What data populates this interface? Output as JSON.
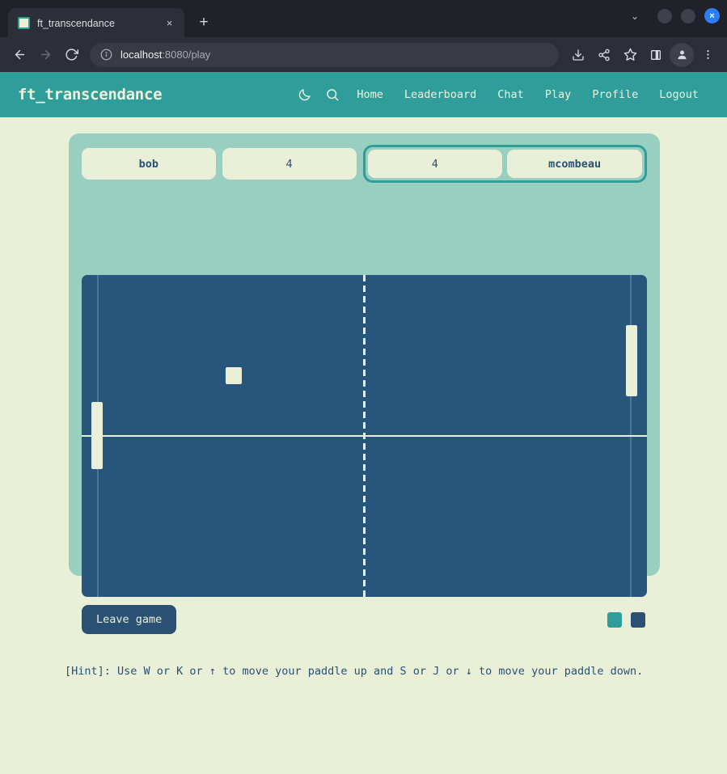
{
  "browser": {
    "tab": {
      "title": "ft_transcendance",
      "favicon": "app-favicon",
      "close_label": "×"
    },
    "new_tab_label": "+",
    "tab_list_chevron": "⌄",
    "window": {
      "minimize": "",
      "maximize": "",
      "close_label": "×"
    },
    "url": {
      "prefix": "localhost",
      "suffix": ":8080/play",
      "full": "localhost:8080/play"
    },
    "nav": {
      "back": "←",
      "forward": "→",
      "reload": "↻"
    }
  },
  "navbar": {
    "brand": "ft_transcendance",
    "icons": [
      {
        "name": "moon-icon",
        "label": "Toggle dark mode"
      },
      {
        "name": "search-icon",
        "label": "Search"
      }
    ],
    "links": [
      {
        "label": "Home"
      },
      {
        "label": "Leaderboard"
      },
      {
        "label": "Chat"
      },
      {
        "label": "Play"
      },
      {
        "label": "Profile"
      },
      {
        "label": "Logout"
      }
    ]
  },
  "game": {
    "players": {
      "left": {
        "name": "bob",
        "score": "4",
        "highlighted": false
      },
      "right": {
        "name": "mcombeau",
        "score": "4",
        "highlighted": true
      }
    },
    "leave_button": "Leave game",
    "swatches": [
      {
        "name": "swatch-cream",
        "color": "#eaf0d8"
      },
      {
        "name": "swatch-teal",
        "color": "#2f9e9a"
      },
      {
        "name": "swatch-navy",
        "color": "#2a5074"
      }
    ],
    "field": {
      "background": "#27557c",
      "ball_color": "#eaf0d8",
      "paddle_color": "#eaf0d8",
      "line_color": "#eaf0d8",
      "boundary_color": "#4d7696"
    }
  },
  "hint": "[Hint]: Use W or K or ↑ to move your paddle up and S or J or ↓ to move your paddle down."
}
